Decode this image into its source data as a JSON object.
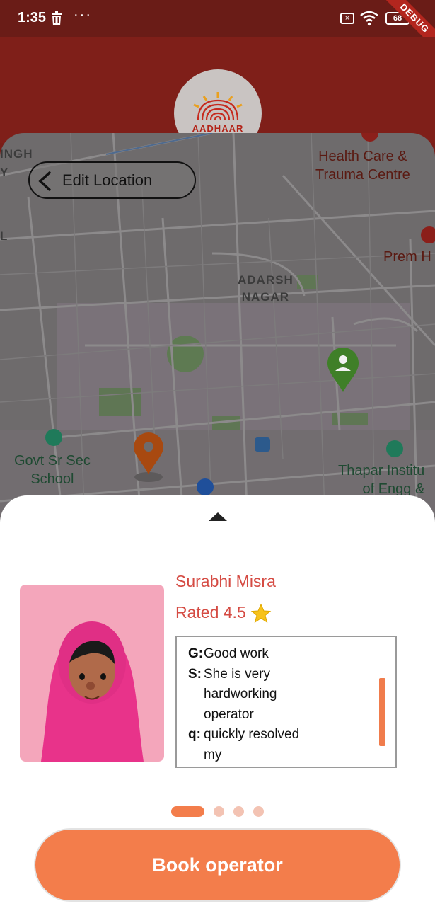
{
  "status_bar": {
    "time": "1:35",
    "battery": "68",
    "icons": [
      "trash-icon",
      "more-dots-icon",
      "no-sim-icon",
      "wifi-icon",
      "battery-icon"
    ]
  },
  "debug_banner": "DEBUG",
  "header": {
    "logo_text": "AADHAAR",
    "background_color": "#7f1f19"
  },
  "map": {
    "back_button_label": "Edit Location",
    "places": {
      "singh_fragment": "INGH",
      "y_fragment": "Y",
      "l_fragment": "L",
      "health_care": "Health Care &\nTrauma Centre",
      "prem": "Prem H",
      "adarsh_nagar": "ADARSH\nNAGAR",
      "govt_school": "Govt Sr Sec\nSchool",
      "thapar": "Thapar Institu\nof Engg &"
    },
    "markers": [
      "operator-location-pin",
      "user-location-pin"
    ]
  },
  "operator": {
    "name": "Surabhi Misra",
    "rating_text": "Rated 4.5",
    "reviews": [
      {
        "initial": "G:",
        "text": "Good work"
      },
      {
        "initial": "S:",
        "text": "She is very hardworking operator"
      },
      {
        "initial": "q:",
        "text": "quickly resolved my"
      }
    ]
  },
  "carousel": {
    "pages": 4,
    "active_index": 0
  },
  "book_button_label": "Book operator",
  "accent_color": "#f37d4b",
  "name_color": "#d54b43"
}
